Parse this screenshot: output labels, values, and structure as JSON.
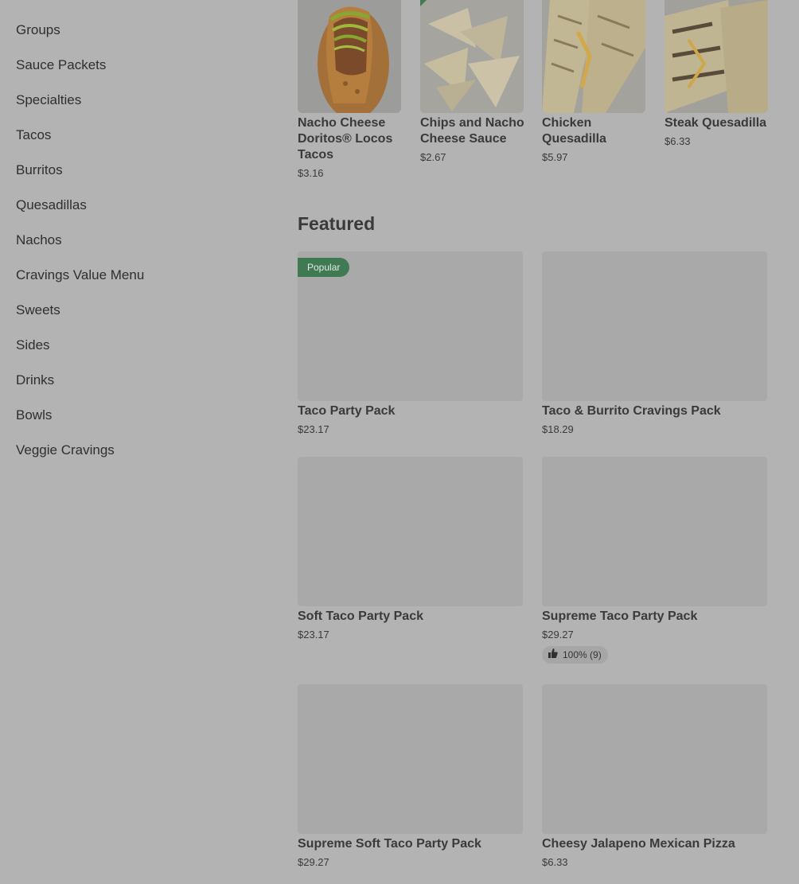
{
  "sidebar": {
    "items": [
      {
        "label": "Groups"
      },
      {
        "label": "Sauce Packets"
      },
      {
        "label": "Specialties"
      },
      {
        "label": "Tacos"
      },
      {
        "label": "Burritos"
      },
      {
        "label": "Quesadillas"
      },
      {
        "label": "Nachos"
      },
      {
        "label": "Cravings Value Menu"
      },
      {
        "label": "Sweets"
      },
      {
        "label": "Sides"
      },
      {
        "label": "Drinks"
      },
      {
        "label": "Bowls"
      },
      {
        "label": "Veggie Cravings"
      }
    ]
  },
  "carousel": {
    "items": [
      {
        "name": "Nacho Cheese Doritos® Locos Tacos",
        "price": "$3.16"
      },
      {
        "name": "Chips and Nacho Cheese Sauce",
        "price": "$2.67"
      },
      {
        "name": "Chicken Quesadilla",
        "price": "$5.97"
      },
      {
        "name": "Steak Quesadilla",
        "price": "$6.33"
      }
    ]
  },
  "featured": {
    "title": "Featured",
    "items": [
      {
        "name": "Taco Party Pack",
        "price": "$23.17",
        "badge": "Popular"
      },
      {
        "name": "Taco & Burrito Cravings Pack",
        "price": "$18.29"
      },
      {
        "name": "Soft Taco Party Pack",
        "price": "$23.17"
      },
      {
        "name": "Supreme Taco Party Pack",
        "price": "$29.27",
        "rating": "100% (9)"
      },
      {
        "name": "Supreme Soft Taco Party Pack",
        "price": "$29.27"
      },
      {
        "name": "Cheesy Jalapeno Mexican Pizza",
        "price": "$6.33"
      }
    ]
  },
  "colors": {
    "overlay_background": "#b3b3b3",
    "badge_green": "#3f7a52",
    "text": "#2f2f2f"
  }
}
